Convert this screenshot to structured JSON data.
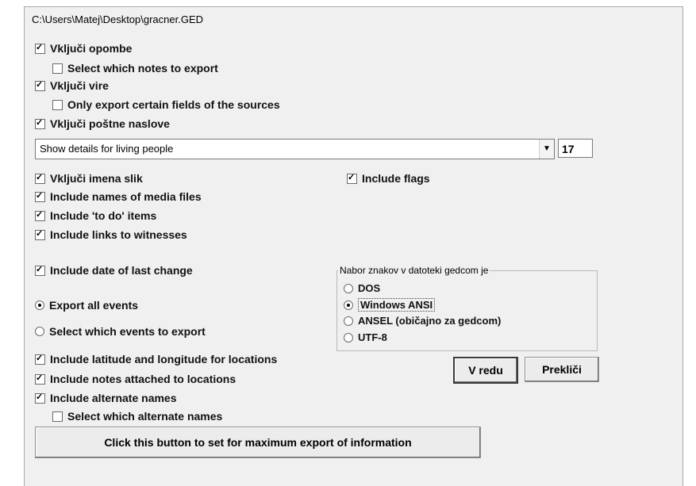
{
  "file_path": "C:\\Users\\Matej\\Desktop\\gracner.GED",
  "options": {
    "include_notes": {
      "label": "Vključi opombe",
      "checked": true
    },
    "select_notes": {
      "label": "Select which notes to export",
      "checked": false
    },
    "include_sources": {
      "label": "Vključi vire",
      "checked": true
    },
    "export_certain_source_fields": {
      "label": "Only export certain fields of the sources",
      "checked": false
    },
    "include_postal_addresses": {
      "label": "Vključi poštne naslove",
      "checked": true
    },
    "include_image_names": {
      "label": "Vključi imena slik",
      "checked": true
    },
    "include_flags": {
      "label": "Include flags",
      "checked": true
    },
    "include_media_file_names": {
      "label": "Include names of media files",
      "checked": true
    },
    "include_todo_items": {
      "label": "Include 'to do' items",
      "checked": true
    },
    "include_witness_links": {
      "label": "Include links to witnesses",
      "checked": true
    },
    "include_last_change_date": {
      "label": "Include date of last change",
      "checked": true
    },
    "include_lat_long": {
      "label": "Include latitude and longitude for locations",
      "checked": true
    },
    "include_location_notes": {
      "label": "Include notes attached to locations",
      "checked": true
    },
    "include_alternate_names": {
      "label": "Include alternate names",
      "checked": true
    },
    "select_alternate_names": {
      "label": "Select which alternate names",
      "checked": false
    }
  },
  "living_people": {
    "selected": "Show details for living people",
    "value": "17"
  },
  "events": {
    "all": {
      "label": "Export all events",
      "selected": true
    },
    "select": {
      "label": "Select which events to export",
      "selected": false
    }
  },
  "charset": {
    "title": "Nabor znakov v datoteki gedcom je",
    "options": [
      {
        "label": "DOS",
        "selected": false
      },
      {
        "label": "Windows ANSI",
        "selected": true
      },
      {
        "label": "ANSEL (običajno za gedcom)",
        "selected": false
      },
      {
        "label": "UTF-8",
        "selected": false
      }
    ]
  },
  "buttons": {
    "ok": "V redu",
    "cancel": "Prekliči",
    "max_export": "Click this button to set for maximum export of information"
  }
}
